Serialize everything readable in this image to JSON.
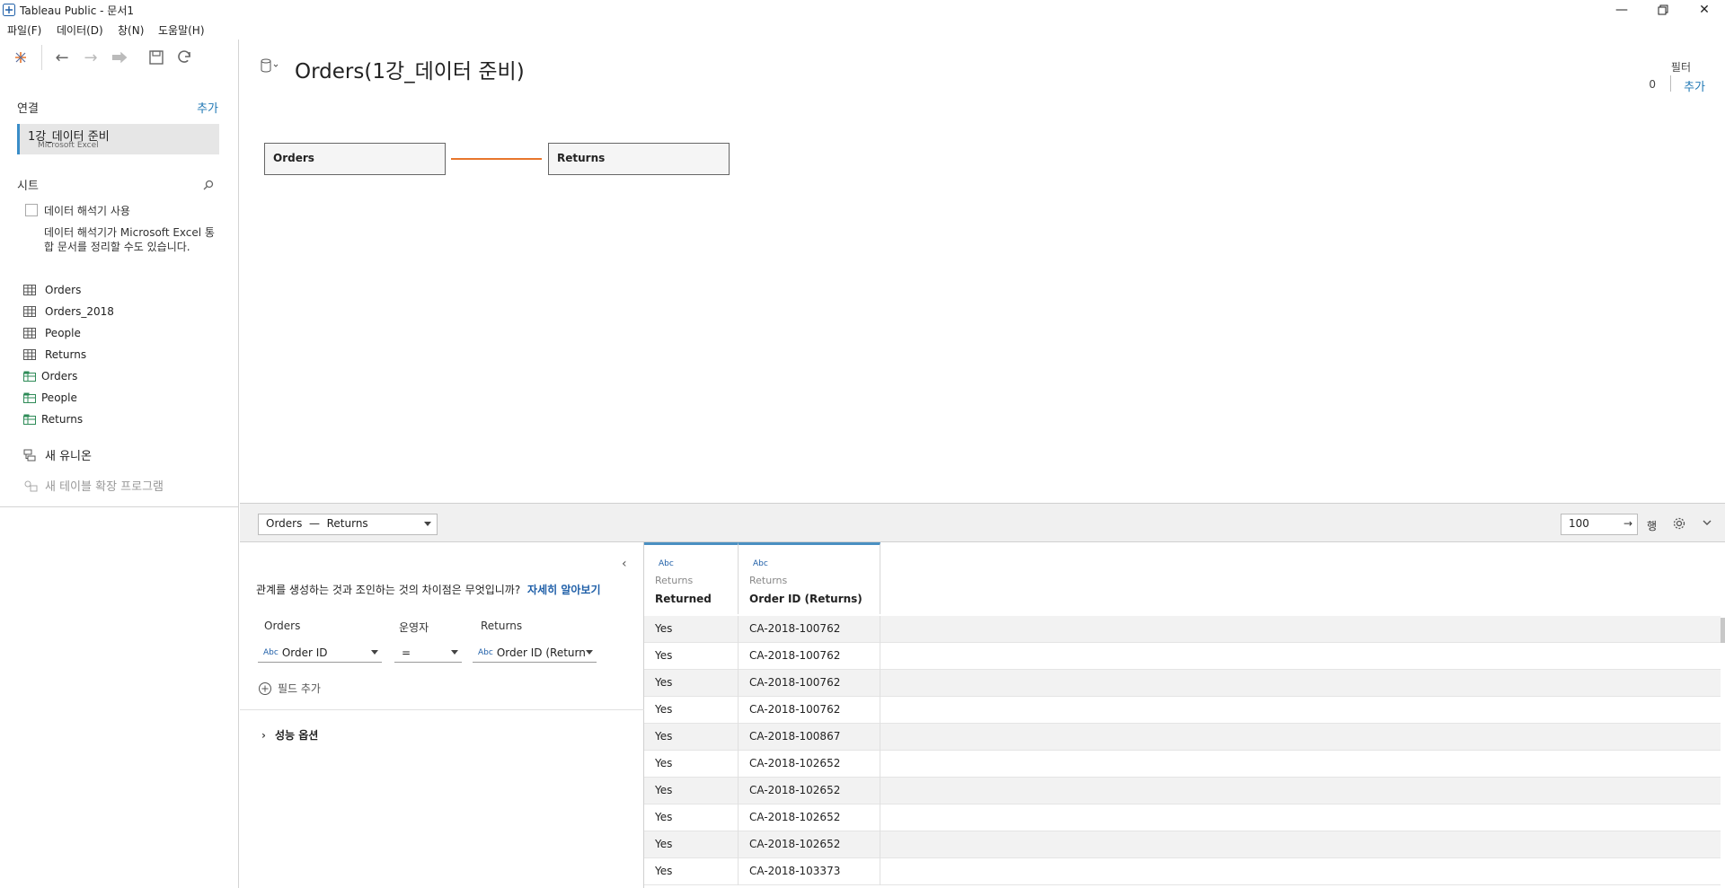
{
  "window": {
    "title": "Tableau Public - 문서1"
  },
  "menu": [
    "파일(F)",
    "데이터(D)",
    "창(N)",
    "도움말(H)"
  ],
  "left": {
    "connections_label": "연결",
    "add_label": "추가",
    "connection": {
      "name": "1강_데이터 준비",
      "type": "Microsoft Excel"
    },
    "sheets_label": "시트",
    "interpreter_label": "데이터 해석기 사용",
    "interpreter_desc": "데이터 해석기가 Microsoft Excel 통합 문서를 정리할 수도 있습니다.",
    "sheets": [
      "Orders",
      "Orders_2018",
      "People",
      "Returns"
    ],
    "named_ranges": [
      "Orders",
      "People",
      "Returns"
    ],
    "new_union": "새 유니온",
    "new_extension": "새 테이블 확장 프로그램"
  },
  "canvas": {
    "title": "Orders(1강_데이터 준비)",
    "filter_label": "필터",
    "filter_count": "0",
    "filter_add": "추가",
    "left_table": "Orders",
    "right_table": "Returns",
    "relation_color": "#e8762c"
  },
  "bottom": {
    "relation_select": "Orders  —  Returns",
    "rows_value": "100",
    "rows_label": "행"
  },
  "relationship": {
    "question": "관계를 생성하는 것과 조인하는 것의 차이점은 무엇입니까?",
    "learn_more": "자세히 알아보기",
    "col_left": "Orders",
    "col_op": "운영자",
    "col_right": "Returns",
    "left_field": "Order ID",
    "operator": "=",
    "right_field": "Order ID (Return",
    "type_label": "Abc",
    "add_field": "필드 추가",
    "performance": "성능 옵션"
  },
  "grid": {
    "columns": [
      {
        "type": "Abc",
        "source": "Returns",
        "name": "Returned"
      },
      {
        "type": "Abc",
        "source": "Returns",
        "name": "Order ID (Returns)"
      }
    ],
    "rows": [
      [
        "Yes",
        "CA-2018-100762"
      ],
      [
        "Yes",
        "CA-2018-100762"
      ],
      [
        "Yes",
        "CA-2018-100762"
      ],
      [
        "Yes",
        "CA-2018-100762"
      ],
      [
        "Yes",
        "CA-2018-100867"
      ],
      [
        "Yes",
        "CA-2018-102652"
      ],
      [
        "Yes",
        "CA-2018-102652"
      ],
      [
        "Yes",
        "CA-2018-102652"
      ],
      [
        "Yes",
        "CA-2018-102652"
      ],
      [
        "Yes",
        "CA-2018-103373"
      ]
    ]
  }
}
